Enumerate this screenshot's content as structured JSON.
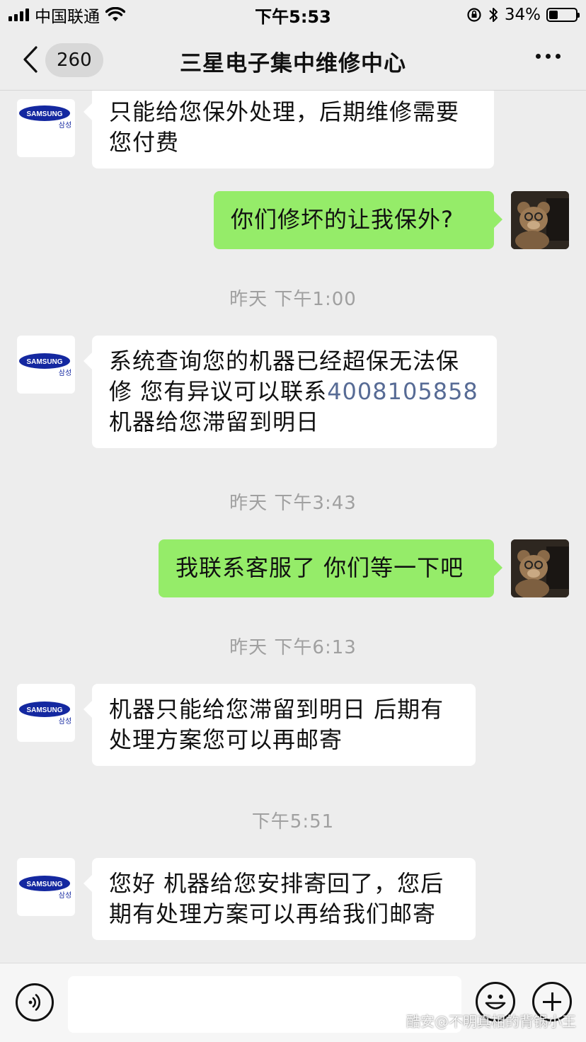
{
  "status_bar": {
    "carrier": "中国联通",
    "time": "下午5:53",
    "battery": "34%",
    "battery_level": 0.34
  },
  "nav": {
    "unread_count": "260",
    "title": "三星电子集中维修中心"
  },
  "messages": [
    {
      "type": "incoming",
      "text": "只能给您保外处理，后期维修需要您付费"
    },
    {
      "type": "outgoing",
      "text": "你们修坏的让我保外?"
    },
    {
      "type": "timestamp",
      "text": "昨天 下午1:00"
    },
    {
      "type": "incoming",
      "text_before": "系统查询您的机器已经超保无法保修 您有异议可以联系",
      "phone": "4008105858",
      "text_after": " 机器给您滞留到明日"
    },
    {
      "type": "timestamp",
      "text": "昨天 下午3:43"
    },
    {
      "type": "outgoing",
      "text": "我联系客服了 你们等一下吧"
    },
    {
      "type": "timestamp",
      "text": "昨天 下午6:13"
    },
    {
      "type": "incoming",
      "text": "机器只能给您滞留到明日 后期有处理方案您可以再邮寄"
    },
    {
      "type": "timestamp",
      "text": "下午5:51"
    },
    {
      "type": "incoming",
      "text": "您好 机器给您安排寄回了，您后期有处理方案可以再给我们邮寄"
    }
  ],
  "avatar": {
    "brand_text": "SAMSUNG",
    "brand_korean": "삼성",
    "brand_color": "#1428a0"
  },
  "input_bar": {
    "placeholder": ""
  },
  "watermark": "酷安@不明真相的背锅小王",
  "colors": {
    "background": "#ededed",
    "outgoing_bubble": "#95ec69",
    "incoming_bubble": "#ffffff",
    "link": "#576b95",
    "timestamp": "#a0a0a0"
  }
}
